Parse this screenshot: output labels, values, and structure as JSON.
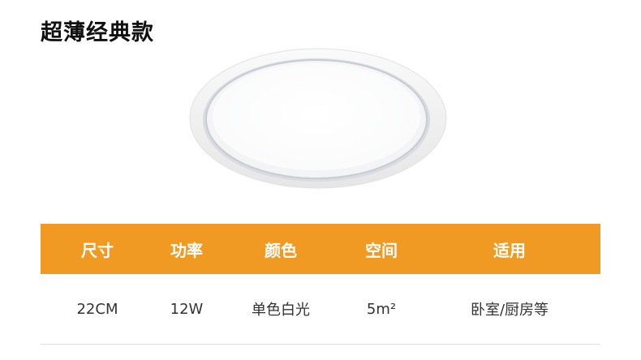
{
  "page": {
    "title": "超薄经典款"
  },
  "spec_table": {
    "headers": [
      "尺寸",
      "功率",
      "颜色",
      "空间",
      "适用"
    ],
    "row": [
      "22CM",
      "12W",
      "单色白光",
      "5m²",
      "卧室/厨房等"
    ],
    "header_color": "#f19a23"
  },
  "product_image": {
    "icon": "ceiling-light-image"
  }
}
